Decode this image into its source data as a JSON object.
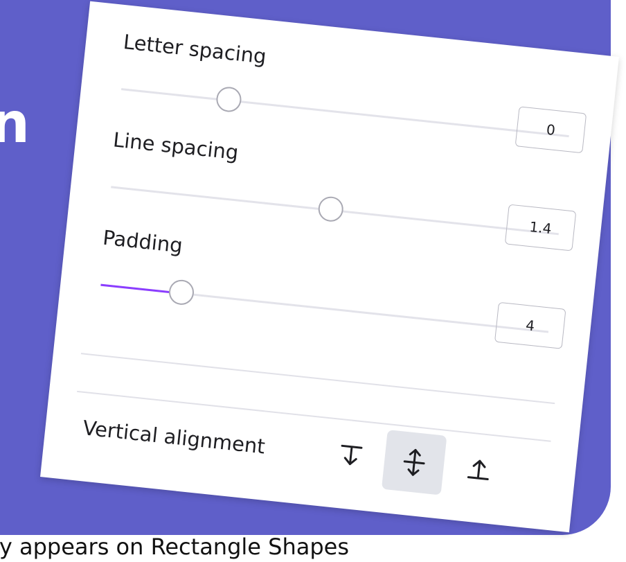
{
  "sliders": [
    {
      "label": "Letter spacing",
      "value": "0",
      "level": 0.24,
      "filled": false
    },
    {
      "label": "Line spacing",
      "value": "1.4",
      "level": 0.49,
      "filled": false
    },
    {
      "label": "Padding",
      "value": "4",
      "level": 0.18,
      "filled": true
    }
  ],
  "vertical_alignment": {
    "label": "Vertical alignment",
    "options": [
      {
        "icon": "align-top-icon",
        "active": false
      },
      {
        "icon": "align-middle-icon",
        "active": true
      },
      {
        "icon": "align-bottom-icon",
        "active": false
      }
    ]
  },
  "background_text": {
    "partial_heading": "n",
    "caption": "ly appears on Rectangle Shapes"
  },
  "colors": {
    "background": "#5f5fc9",
    "accent": "#8b3dff",
    "track": "#e3e3ea",
    "active_button": "#e2e4ea"
  }
}
